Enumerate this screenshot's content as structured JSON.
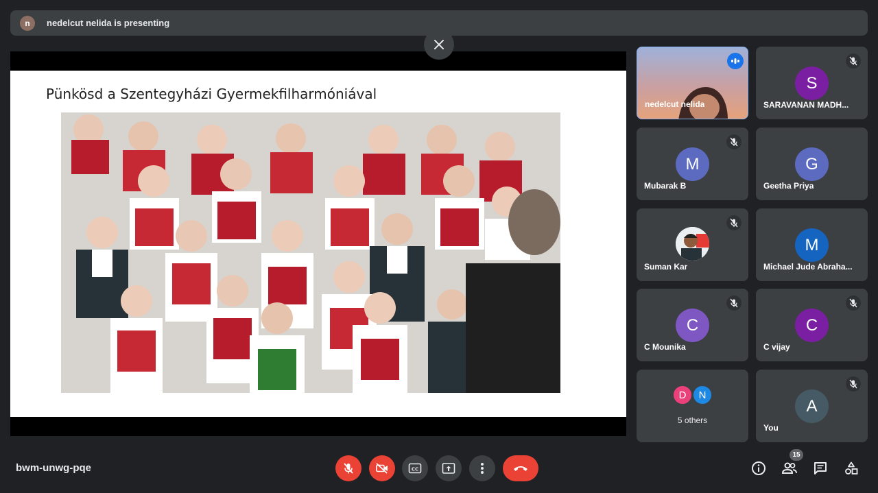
{
  "banner": {
    "avatar_letter": "n",
    "text": "nedelcut nelida is presenting"
  },
  "slide": {
    "title": "Pünkösd a Szentegyházi Gyermekfilharmóniával"
  },
  "tiles": [
    {
      "name": "nedelcut nelida",
      "speaking": true
    },
    {
      "name": "SARAVANAN MADH...",
      "letter": "S",
      "color": "#7b1fa2"
    },
    {
      "name": "Mubarak B",
      "letter": "M",
      "color": "#5c6bc0"
    },
    {
      "name": "Geetha Priya",
      "letter": "G",
      "color": "#5c6bc0"
    },
    {
      "name": "Suman Kar"
    },
    {
      "name": "Michael Jude Abraha...",
      "letter": "M",
      "color": "#1565c0"
    },
    {
      "name": "C Mounika",
      "letter": "C",
      "color": "#7e57c2"
    },
    {
      "name": "C vijay",
      "letter": "C",
      "color": "#7b1fa2"
    },
    {
      "others_label": "5 others",
      "letters": [
        "D",
        "N"
      ],
      "colors": [
        "#ec407a",
        "#1e88e5"
      ]
    },
    {
      "name": "You",
      "letter": "A",
      "color": "#455a64"
    }
  ],
  "bottom": {
    "meeting_code": "bwm-unwg-pqe",
    "participant_count": "15"
  },
  "colors": {
    "background": "#202124",
    "surface": "#3c4043",
    "danger": "#ea4335",
    "accent": "#1a73e8"
  }
}
